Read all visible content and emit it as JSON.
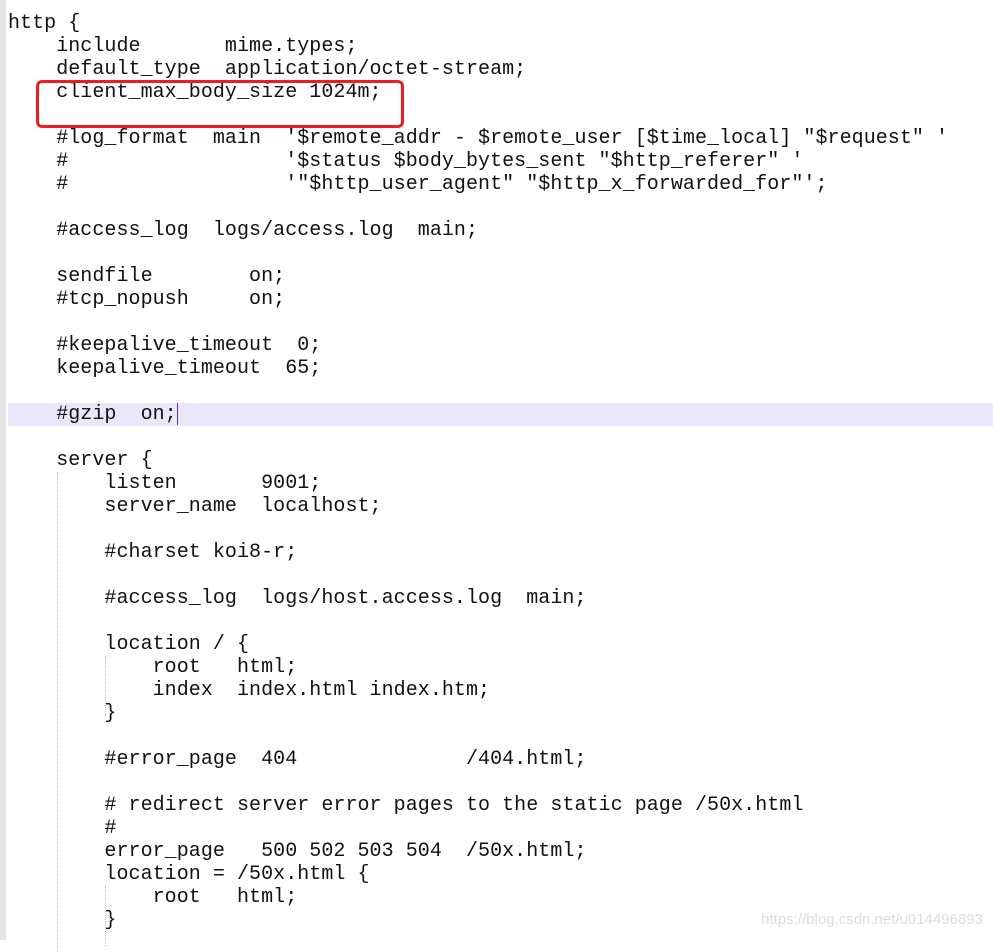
{
  "editor": {
    "current_line_index": 17,
    "highlighted_line_index": 3,
    "lines": [
      "http {",
      "    include       mime.types;",
      "    default_type  application/octet-stream;",
      "    client_max_body_size 1024m;",
      "",
      "    #log_format  main  '$remote_addr - $remote_user [$time_local] \"$request\" '",
      "    #                  '$status $body_bytes_sent \"$http_referer\" '",
      "    #                  '\"$http_user_agent\" \"$http_x_forwarded_for\"';",
      "",
      "    #access_log  logs/access.log  main;",
      "",
      "    sendfile        on;",
      "    #tcp_nopush     on;",
      "",
      "    #keepalive_timeout  0;",
      "    keepalive_timeout  65;",
      "",
      "    #gzip  on;",
      "",
      "    server {",
      "        listen       9001;",
      "        server_name  localhost;",
      "",
      "        #charset koi8-r;",
      "",
      "        #access_log  logs/host.access.log  main;",
      "",
      "        location / {",
      "            root   html;",
      "            index  index.html index.htm;",
      "        }",
      "",
      "        #error_page  404              /404.html;",
      "",
      "        # redirect server error pages to the static page /50x.html",
      "        #",
      "        error_page   500 502 503 504  /50x.html;",
      "        location = /50x.html {",
      "            root   html;",
      "        }"
    ]
  },
  "colors": {
    "highlight_box": "#ee1c1c",
    "current_line": "#e8e8fa",
    "text": "#111111"
  },
  "watermark": "https://blog.csdn.net/u014496893"
}
